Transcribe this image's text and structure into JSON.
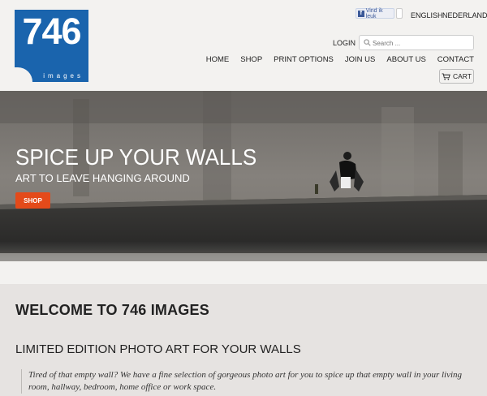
{
  "logo": {
    "number": "746",
    "sub": "images",
    "brand_color": "#1a64ad"
  },
  "top": {
    "fb_like": "Vind ik leuk",
    "lang_en": "ENGLISH",
    "lang_nl": "NEDERLANDS",
    "login": "LOGIN",
    "search_placeholder": "Search ..."
  },
  "nav": {
    "items": [
      {
        "label": "HOME"
      },
      {
        "label": "SHOP"
      },
      {
        "label": "PRINT OPTIONS"
      },
      {
        "label": "JOIN US"
      },
      {
        "label": "ABOUT US"
      },
      {
        "label": "CONTACT"
      }
    ]
  },
  "cart": {
    "label": "CART",
    "icon": "cart-icon"
  },
  "hero": {
    "title": "SPICE UP YOUR WALLS",
    "subtitle": "ART TO LEAVE HANGING AROUND",
    "button": "SHOP",
    "accent": "#e44a1a"
  },
  "content": {
    "welcome": "WELCOME TO 746 IMAGES",
    "heading": "LIMITED EDITION PHOTO ART FOR YOUR WALLS",
    "quote": "Tired of that empty wall? We have a fine selection of gorgeous photo art for you to spice up that empty wall in your living room, hallway, bedroom, home office or work space."
  }
}
